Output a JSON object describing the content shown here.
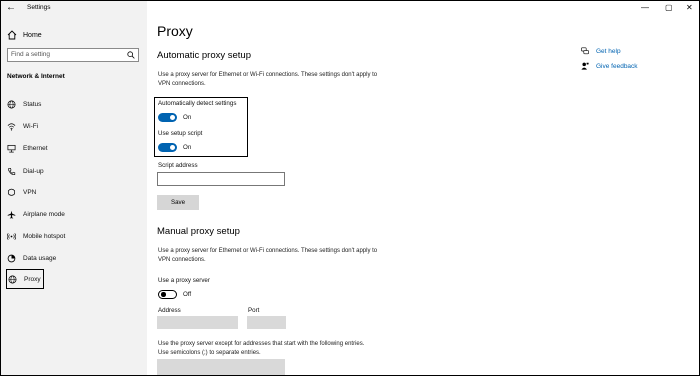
{
  "window": {
    "title": "Settings",
    "controls": [
      "—",
      "▢",
      "✕"
    ]
  },
  "sidebar": {
    "home_label": "Home",
    "search_placeholder": "Find a setting",
    "section_title": "Network & Internet",
    "items": [
      {
        "label": "Status",
        "icon": "globe-status-icon"
      },
      {
        "label": "Wi-Fi",
        "icon": "wifi-icon"
      },
      {
        "label": "Ethernet",
        "icon": "ethernet-icon"
      },
      {
        "label": "Dial-up",
        "icon": "phone-icon"
      },
      {
        "label": "VPN",
        "icon": "vpn-icon"
      },
      {
        "label": "Airplane mode",
        "icon": "airplane-icon"
      },
      {
        "label": "Mobile hotspot",
        "icon": "hotspot-icon"
      },
      {
        "label": "Data usage",
        "icon": "data-usage-icon"
      },
      {
        "label": "Proxy",
        "icon": "globe-icon",
        "selected": true
      }
    ]
  },
  "main": {
    "title": "Proxy",
    "auto": {
      "heading": "Automatic proxy setup",
      "description": "Use a proxy server for Ethernet or Wi-Fi connections. These settings don't apply to VPN connections.",
      "detect_label": "Automatically detect settings",
      "detect_state": "On",
      "script_label": "Use setup script",
      "script_state": "On",
      "script_address_label": "Script address",
      "script_address_value": "",
      "save_label": "Save"
    },
    "manual": {
      "heading": "Manual proxy setup",
      "description": "Use a proxy server for Ethernet or Wi-Fi connections. These settings don't apply to VPN connections.",
      "use_proxy_label": "Use a proxy server",
      "use_proxy_state": "Off",
      "address_label": "Address",
      "port_label": "Port",
      "exceptions_description": "Use the proxy server except for addresses that start with the following entries. Use semicolons (;) to separate entries."
    }
  },
  "help": {
    "get_help": "Get help",
    "give_feedback": "Give feedback"
  },
  "colors": {
    "accent": "#0063b1",
    "sidebar_bg": "#f2f2f2",
    "disabled_field": "#d9d9d9"
  }
}
